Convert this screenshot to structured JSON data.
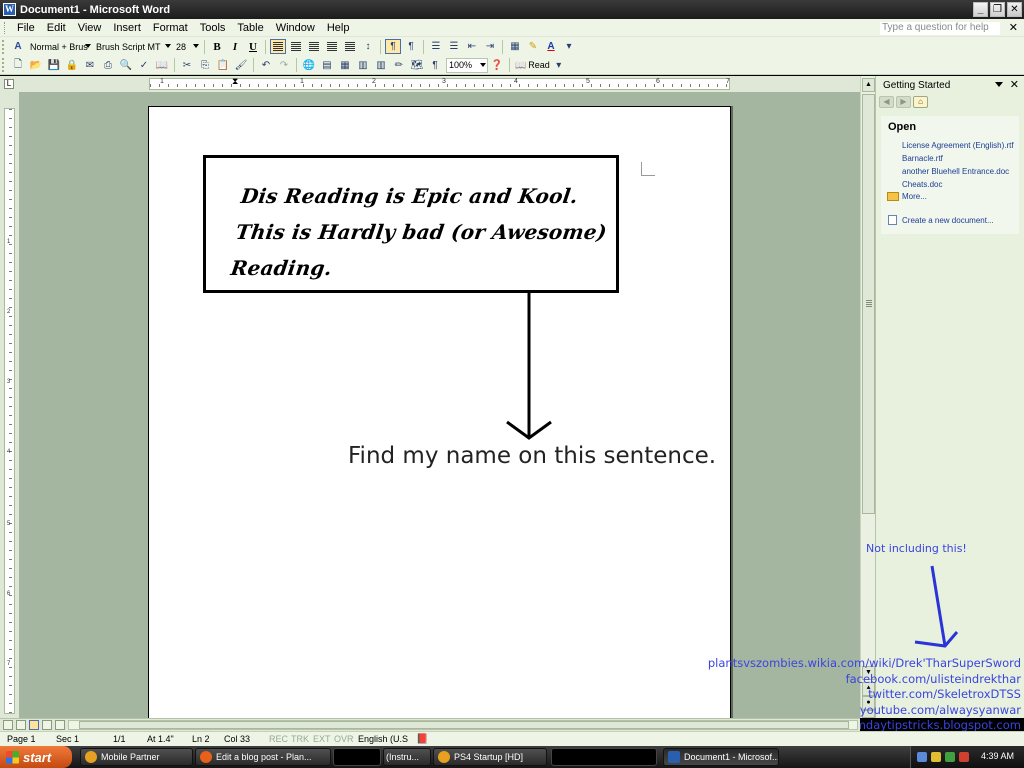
{
  "window": {
    "title": "Document1 - Microsoft Word"
  },
  "menu": {
    "items": [
      "File",
      "Edit",
      "View",
      "Insert",
      "Format",
      "Tools",
      "Table",
      "Window",
      "Help"
    ],
    "ask_placeholder": "Type a question for help"
  },
  "format_toolbar": {
    "style": "Normal + Brus",
    "font": "Brush Script MT",
    "size": "28",
    "bold": "B",
    "italic": "I",
    "underline": "U"
  },
  "standard_toolbar": {
    "zoom": "100%",
    "read_label": "Read"
  },
  "ruler": {
    "marks": [
      "1",
      "1",
      "2",
      "3",
      "4",
      "5",
      "6",
      "7"
    ],
    "vmarks": [
      "1",
      "2",
      "3",
      "4",
      "5",
      "6",
      "7"
    ]
  },
  "document": {
    "callout_text": "Dis Reading is Epic and Kool. This is Hardly bad (or Awesome) Reading.",
    "sentence": "Find my name on this sentence."
  },
  "task_pane": {
    "title": "Getting Started",
    "open_heading": "Open",
    "files": [
      "License Agreement (English).rtf",
      "Barnacle.rtf",
      "another Bluehell Entrance.doc",
      "Cheats.doc"
    ],
    "more": "More...",
    "new_doc": "Create a new document..."
  },
  "overlay": {
    "note": "Not including this!",
    "links": [
      "plantsvszombies.wikia.com/wiki/Drek'TharSuperSword",
      "facebook.com/ulisteindrekthar",
      "twitter.com/SkeletroxDTSS",
      "youtube.com/alwaysyanwar",
      "randomdaytipstricks.blogspot.com"
    ]
  },
  "status": {
    "page": "Page 1",
    "sec": "Sec 1",
    "pages": "1/1",
    "at": "At 1.4\"",
    "ln": "Ln 2",
    "col": "Col 33",
    "rec": "REC",
    "trk": "TRK",
    "ext": "EXT",
    "ovr": "OVR",
    "lang": "English (U.S"
  },
  "taskbar": {
    "start": "start",
    "tasks": [
      "Mobile Partner",
      "Edit a blog post - Plan...",
      "(Instru...",
      "PS4 Startup  [HD]",
      "Document1 - Microsof..."
    ],
    "clock": "4:39 AM"
  },
  "colors": {
    "annotation_blue": "#3a44e0",
    "chrome_green": "#eef5e6",
    "doc_bg": "#a4b6a0"
  }
}
